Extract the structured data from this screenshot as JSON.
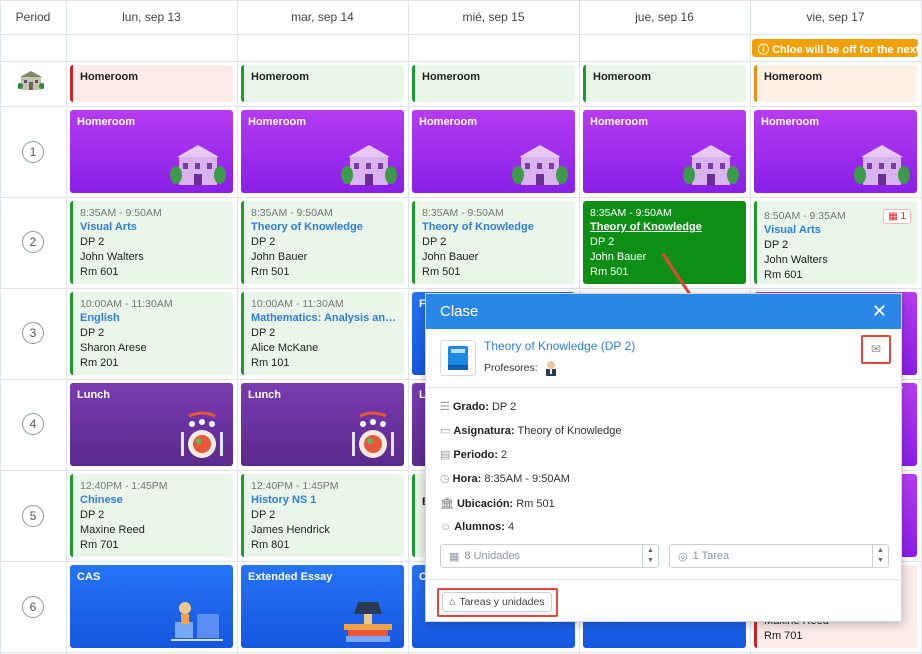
{
  "header": {
    "period_label": "Period",
    "days": [
      "lun, sep 13",
      "mar, sep 14",
      "mié, sep 15",
      "jue, sep 16",
      "vie, sep 17"
    ]
  },
  "notice": "Chloe will be off for the next",
  "periods": [
    "1",
    "2",
    "3",
    "4",
    "5",
    "6"
  ],
  "rows": {
    "homeroom_pre": [
      "Homeroom",
      "Homeroom",
      "Homeroom",
      "Homeroom",
      "Homeroom"
    ],
    "p1": [
      "Homeroom",
      "Homeroom",
      "Homeroom",
      "Homeroom",
      "Homeroom"
    ],
    "p2": [
      {
        "time": "8:35AM - 9:50AM",
        "subject": "Visual Arts",
        "grade": "DP 2",
        "teacher": "John Walters",
        "room": "Rm 601"
      },
      {
        "time": "8:35AM - 9:50AM",
        "subject": "Theory of Knowledge",
        "grade": "DP 2",
        "teacher": "John Bauer",
        "room": "Rm 501"
      },
      {
        "time": "8:35AM - 9:50AM",
        "subject": "Theory of Knowledge",
        "grade": "DP 2",
        "teacher": "John Bauer",
        "room": "Rm 501"
      },
      {
        "time": "8:35AM - 9:50AM",
        "subject": "Theory of Knowledge",
        "grade": "DP 2",
        "teacher": "John Bauer",
        "room": "Rm 501"
      },
      {
        "time": "8:50AM - 9:35AM",
        "subject": "Visual Arts",
        "grade": "DP 2",
        "teacher": "John Walters",
        "room": "Rm 601",
        "badge": "1"
      }
    ],
    "p3": [
      {
        "time": "10:00AM - 11:30AM",
        "subject": "English",
        "grade": "DP 2",
        "teacher": "Sharon Arese",
        "room": "Rm 201"
      },
      {
        "time": "10:00AM - 11:30AM",
        "subject": "Mathematics: Analysis and Approaches",
        "grade": "DP 2",
        "teacher": "Alice McKane",
        "room": "Rm 101"
      },
      {
        "short": "Fr"
      }
    ],
    "p4": [
      "Lunch",
      "Lunch",
      "Lu"
    ],
    "p5": [
      {
        "time": "12:40PM - 1:45PM",
        "subject": "Chinese",
        "grade": "DP 2",
        "teacher": "Maxine Reed",
        "room": "Rm 701"
      },
      {
        "time": "12:40PM - 1:45PM",
        "subject": "History NS 1",
        "grade": "DP 2",
        "teacher": "James Hendrick",
        "room": "Rm 801"
      },
      {
        "short": "E"
      }
    ],
    "p6": [
      "CAS",
      "Extended Essay",
      "C"
    ],
    "p6_fri": {
      "teacher": "Maxine Reed",
      "room": "Rm 701"
    }
  },
  "modal": {
    "title": "Clase",
    "class_name": "Theory of Knowledge (DP 2)",
    "teachers_label": "Profesores:",
    "grade_label": "Grado:",
    "grade_value": "DP 2",
    "subject_label": "Asignatura:",
    "subject_value": "Theory of Knowledge",
    "period_label": "Periodo:",
    "period_value": "2",
    "time_label": "Hora:",
    "time_value": "8:35AM - 9:50AM",
    "location_label": "Ubicación:",
    "location_value": "Rm 501",
    "students_label": "Alumnos:",
    "students_value": "4",
    "units_select": "8 Unidades",
    "tasks_select": "1 Tarea",
    "tasks_button": "Tareas y unidades"
  },
  "colors": {
    "accent_blue": "#2b87e5",
    "homeroom_purple": "#a02ded",
    "lunch_purple": "#6a33a0",
    "class_green": "#0d8f16",
    "annotation_red": "#e5473a",
    "notice_orange": "#f2a007"
  },
  "icons": [
    "school-building-icon",
    "mail-icon",
    "close-icon",
    "book-icon",
    "list-icon",
    "clock-icon",
    "bank-icon",
    "users-icon",
    "calendar-icon",
    "check-circle-icon",
    "folder-icon"
  ]
}
